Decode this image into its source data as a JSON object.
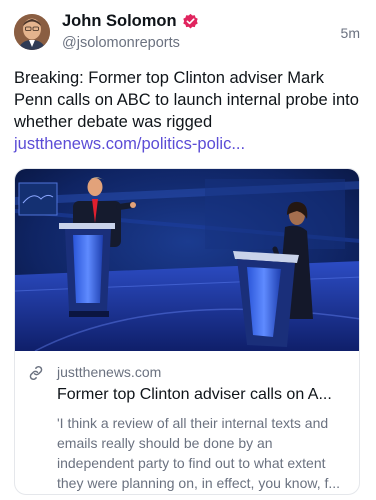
{
  "post": {
    "author_name": "John Solomon",
    "handle": "@jsolomonreports",
    "time": "5m",
    "text": "Breaking: Former top Clinton adviser Mark Penn calls on ABC to launch internal probe into whether debate was rigged ",
    "link_text": "justthenews.com/politics-polic...",
    "icons": {
      "verified": "verified-badge-icon",
      "avatar": "avatar-photo"
    },
    "colors": {
      "link": "#5b4cd6",
      "verified": "#e0245e"
    }
  },
  "link_card": {
    "domain": "justthenews.com",
    "title": "Former top Clinton adviser calls on A...",
    "description": "'I think a review of all their internal texts and emails really should be done by an independent party to find out to what extent they were planning on, in effect, you know, f...",
    "icon": "link-icon",
    "image": "debate-stage-photo"
  }
}
